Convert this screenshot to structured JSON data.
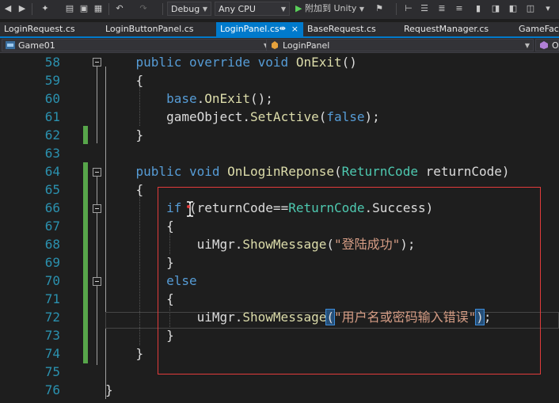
{
  "toolbar": {
    "config": "Debug",
    "platform": "Any CPU",
    "attach_label": "附加到 Unity"
  },
  "tabs": [
    {
      "label": "LoginRequest.cs",
      "active": false
    },
    {
      "label": "LoginButtonPanel.cs",
      "active": false
    },
    {
      "label": "LoginPanel.cs",
      "active": true
    },
    {
      "label": "BaseRequest.cs",
      "active": false
    },
    {
      "label": "RequestManager.cs",
      "active": false
    },
    {
      "label": "GameFaca",
      "active": false
    }
  ],
  "tab_pin": "⇼",
  "tab_close": "×",
  "navbar": {
    "project": "Game01",
    "class": "LoginPanel",
    "member": "On"
  },
  "editor": {
    "lines": [
      {
        "n": "58",
        "tokens": [
          [
            "kw",
            "    public override void "
          ],
          [
            "mt",
            "OnExit"
          ],
          [
            "pl",
            "()"
          ]
        ]
      },
      {
        "n": "59",
        "tokens": [
          [
            "pl",
            "    {"
          ]
        ]
      },
      {
        "n": "60",
        "tokens": [
          [
            "kw",
            "        base"
          ],
          [
            "pl",
            "."
          ],
          [
            "mt",
            "OnExit"
          ],
          [
            "pl",
            "();"
          ]
        ]
      },
      {
        "n": "61",
        "tokens": [
          [
            "pl",
            "        gameObject."
          ],
          [
            "mt",
            "SetActive"
          ],
          [
            "pl",
            "("
          ],
          [
            "kw",
            "false"
          ],
          [
            "pl",
            ");"
          ]
        ]
      },
      {
        "n": "62",
        "tokens": [
          [
            "pl",
            "    }"
          ]
        ]
      },
      {
        "n": "63",
        "tokens": []
      },
      {
        "n": "64",
        "tokens": [
          [
            "kw",
            "    public void "
          ],
          [
            "mt",
            "OnLoginReponse"
          ],
          [
            "pl",
            "("
          ],
          [
            "ty",
            "ReturnCode"
          ],
          [
            "pl",
            " returnCode)"
          ]
        ]
      },
      {
        "n": "65",
        "tokens": [
          [
            "pl",
            "    {"
          ]
        ]
      },
      {
        "n": "66",
        "tokens": [
          [
            "kw",
            "        if "
          ],
          [
            "pl",
            "(returnCode=="
          ],
          [
            "ty",
            "ReturnCode"
          ],
          [
            "pl",
            ".Success)"
          ]
        ]
      },
      {
        "n": "67",
        "tokens": [
          [
            "pl",
            "        {"
          ]
        ]
      },
      {
        "n": "68",
        "tokens": [
          [
            "pl",
            "            uiMgr."
          ],
          [
            "mt",
            "ShowMessage"
          ],
          [
            "pl",
            "("
          ],
          [
            "st",
            "\"登陆成功\""
          ],
          [
            "pl",
            ");"
          ]
        ]
      },
      {
        "n": "69",
        "tokens": [
          [
            "pl",
            "        }"
          ]
        ]
      },
      {
        "n": "70",
        "tokens": [
          [
            "kw",
            "        else"
          ]
        ]
      },
      {
        "n": "71",
        "tokens": [
          [
            "pl",
            "        {"
          ]
        ]
      },
      {
        "n": "72",
        "tokens": [
          [
            "pl",
            "            uiMgr."
          ],
          [
            "mt",
            "ShowMessage"
          ],
          [
            "sel",
            "("
          ],
          [
            "st",
            "\"用户名或密码输入错误\""
          ],
          [
            "sel",
            ")"
          ],
          [
            "pl",
            ";"
          ]
        ]
      },
      {
        "n": "73",
        "tokens": [
          [
            "pl",
            "        }"
          ]
        ]
      },
      {
        "n": "74",
        "tokens": [
          [
            "pl",
            "    }"
          ]
        ]
      },
      {
        "n": "75",
        "tokens": []
      },
      {
        "n": "76",
        "tokens": [
          [
            "pl",
            "}"
          ]
        ]
      }
    ]
  },
  "colors": {
    "accent": "#007acc",
    "keyword": "#569cd6",
    "type": "#4ec9b0",
    "method": "#dcdcaa",
    "string": "#d69d85",
    "line_number": "#2b91af",
    "change_marker": "#57a64a",
    "annotation_box": "#e23b3b"
  }
}
